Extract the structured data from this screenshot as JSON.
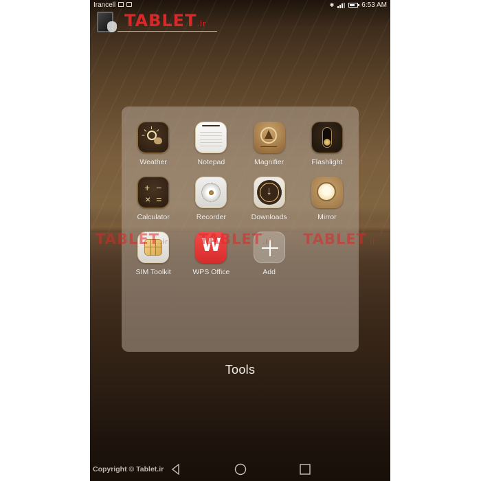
{
  "status_bar": {
    "carrier": "Irancell",
    "time": "6:53 AM",
    "icons": [
      "image-icon",
      "keyboard-icon",
      "bluetooth-icon",
      "signal-icon",
      "battery-icon"
    ]
  },
  "watermark": {
    "logo_text": "TABLET",
    "logo_suffix": ".ir",
    "copyright": "Copyright © Tablet.ir"
  },
  "folder": {
    "name": "Tools",
    "apps": [
      {
        "label": "Weather",
        "icon": "weather-icon"
      },
      {
        "label": "Notepad",
        "icon": "notepad-icon"
      },
      {
        "label": "Magnifier",
        "icon": "magnifier-icon"
      },
      {
        "label": "Flashlight",
        "icon": "flashlight-icon"
      },
      {
        "label": "Calculator",
        "icon": "calculator-icon"
      },
      {
        "label": "Recorder",
        "icon": "recorder-icon"
      },
      {
        "label": "Downloads",
        "icon": "downloads-icon"
      },
      {
        "label": "Mirror",
        "icon": "mirror-icon"
      },
      {
        "label": "SIM Toolkit",
        "icon": "sim-card-icon"
      },
      {
        "label": "WPS Office",
        "icon": "wps-office-icon"
      },
      {
        "label": "Add",
        "icon": "plus-icon"
      }
    ]
  },
  "calculator_symbols": [
    "+",
    "−",
    "×",
    "="
  ],
  "wps_glyph": "W",
  "downloads_glyph": "↓",
  "bluetooth_glyph": "✱",
  "navigation": {
    "back": "back-icon",
    "home": "home-icon",
    "recents": "recents-icon"
  },
  "colors": {
    "wallpaper_top": "#5a4329",
    "wallpaper_bottom": "#180f09",
    "folder_panel": "#afa091",
    "watermark_red": "#d8282a",
    "wps_red": "#e83a3a"
  }
}
